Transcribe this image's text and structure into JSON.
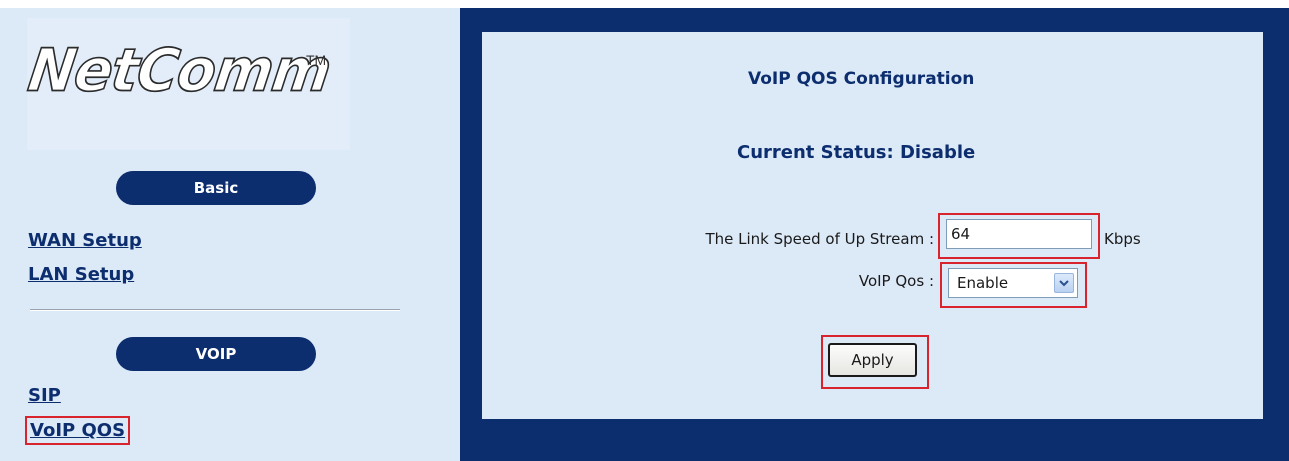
{
  "logo": {
    "brand": "NetComm",
    "trademark": "TM"
  },
  "sidebar": {
    "sections": [
      {
        "label": "Basic",
        "items": [
          {
            "label": "WAN Setup"
          },
          {
            "label": "LAN Setup"
          }
        ]
      },
      {
        "label": "VOIP",
        "items": [
          {
            "label": "SIP"
          },
          {
            "label": "VoIP QOS",
            "selected": true
          }
        ]
      }
    ]
  },
  "main": {
    "title": "VoIP QOS Configuration",
    "status": "Current Status: Disable",
    "form": {
      "link_speed_label": "The Link Speed of Up Stream :",
      "link_speed_value": "64",
      "link_speed_unit": "Kbps",
      "voip_qos_label": "VoIP Qos :",
      "voip_qos_value": "Enable"
    },
    "apply_label": "Apply"
  },
  "colors": {
    "navy": "#0c2d6e",
    "panel": "#dce9f7",
    "highlight": "#d9232d"
  }
}
